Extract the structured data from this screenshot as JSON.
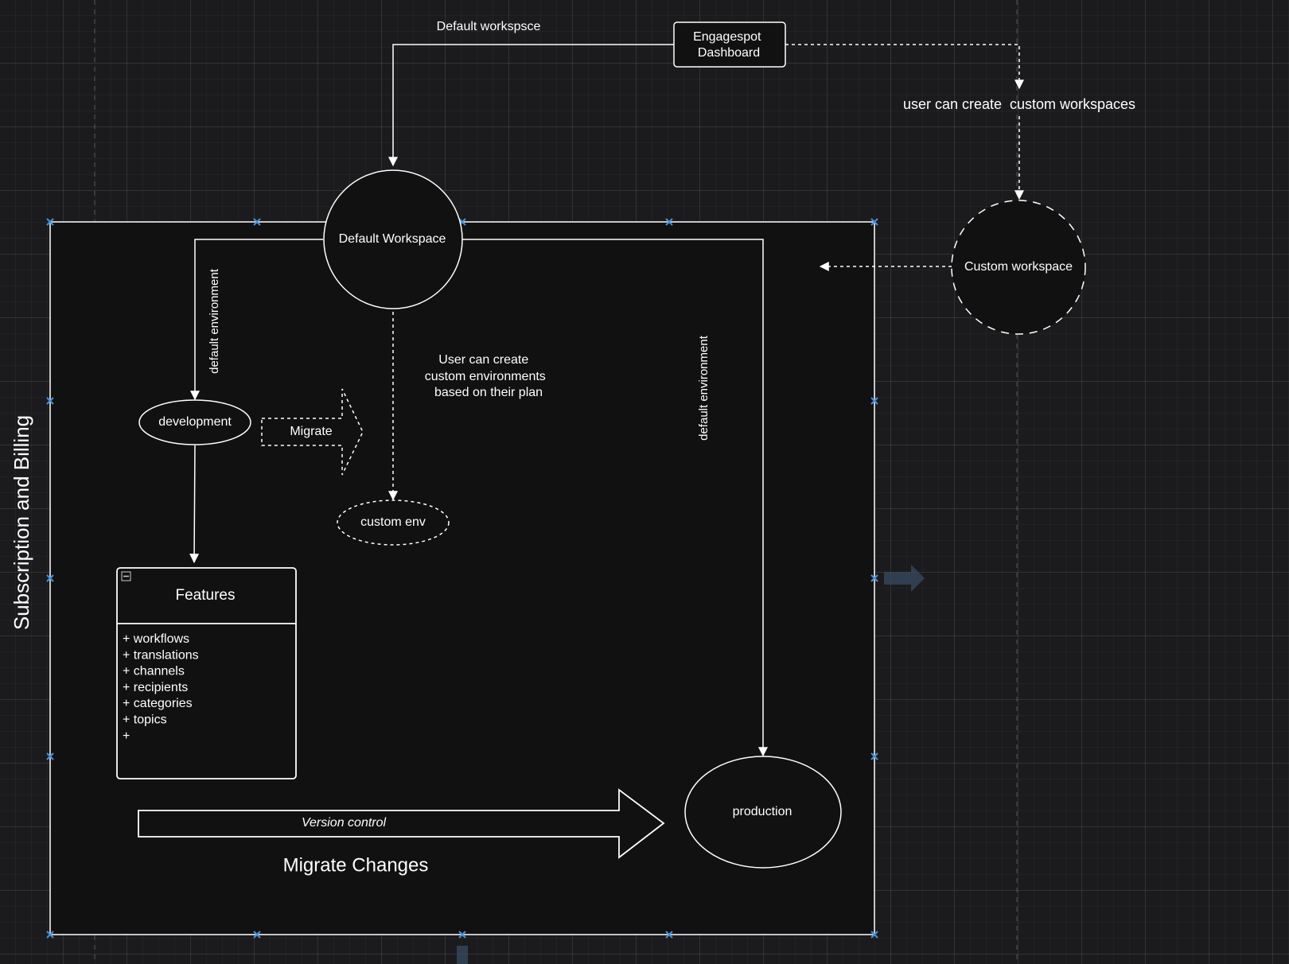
{
  "diagram": {
    "container_label": "Subscription and Billing",
    "nodes": {
      "dashboard": {
        "line1": "Engagespot",
        "line2": "Dashboard"
      },
      "default_workspace": "Default Workspace",
      "custom_workspace": "Custom workspace",
      "development": "development",
      "custom_env": "custom env",
      "production": "production",
      "features": {
        "title": "Features",
        "items": [
          "+ workflows",
          "+ translations",
          "+ channels",
          "+ recipients",
          "+ categories",
          "+ topics",
          "+"
        ]
      }
    },
    "edges": {
      "default_workspace": "Default workspsce",
      "custom_workspaces": "user can create  custom workspaces",
      "dev_default_env": "default environment",
      "prod_default_env": "default environment",
      "custom_envs": {
        "line1": "User can create",
        "line2": "custom environments",
        "line3": "based on their plan"
      }
    },
    "arrows": {
      "migrate": "Migrate",
      "version_control": "Version control",
      "migrate_changes": "Migrate Changes"
    },
    "colors": {
      "background": "#1b1b1d",
      "container_fill": "#111111",
      "stroke": "#ffffff",
      "selection_handle": "#4a90d9"
    }
  }
}
